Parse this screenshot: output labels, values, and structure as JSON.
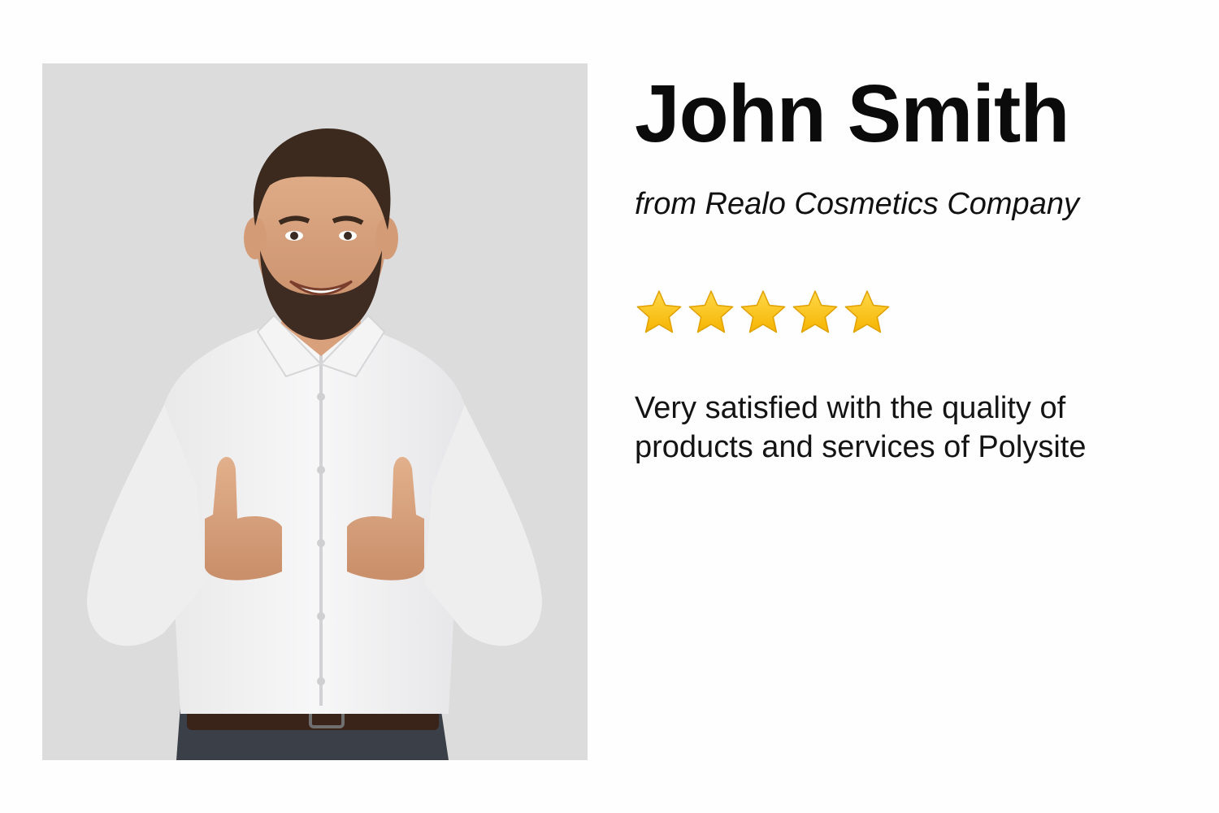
{
  "testimonial": {
    "name": "John Smith",
    "company": "from Realo Cosmetics Company",
    "rating": {
      "value": 5,
      "max": 5,
      "icon": "star-icon",
      "color": "#f5b400"
    },
    "quote": "Very satisfied with the quality of products and services of Polysite",
    "photo": {
      "icon": "person-thumbs-up-photo",
      "background": "#dcdcdc"
    }
  }
}
